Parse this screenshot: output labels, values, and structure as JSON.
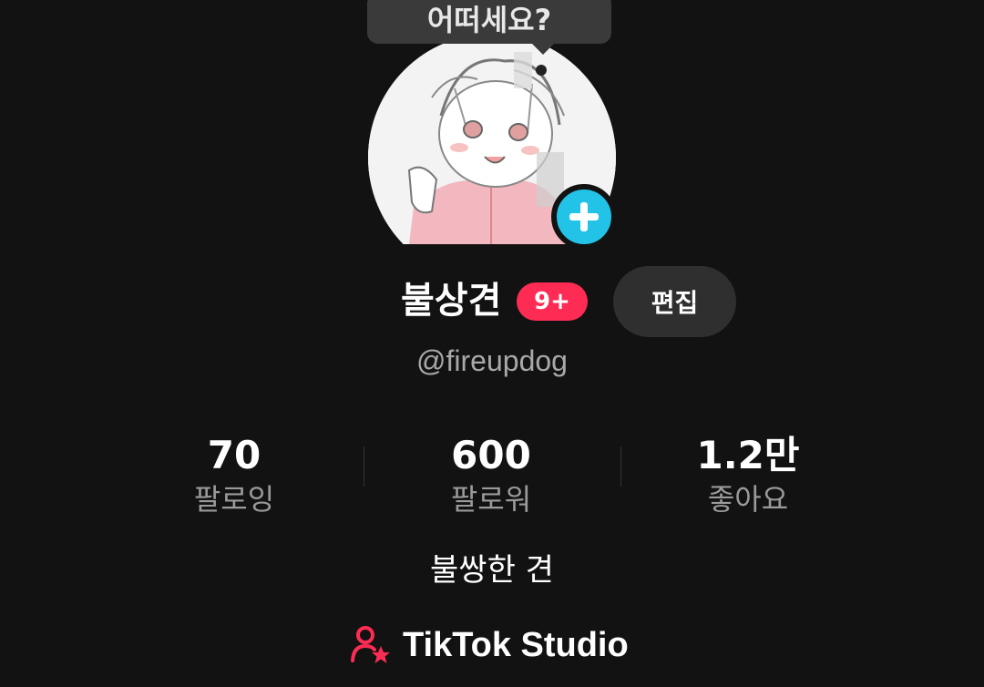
{
  "tooltip": {
    "text": "어떠세요?"
  },
  "profile": {
    "name": "불상견",
    "badge": "9+",
    "edit_label": "편집",
    "handle": "@fireupdog",
    "bio": "불쌍한 견"
  },
  "stats": [
    {
      "value": "70",
      "label": "팔로잉"
    },
    {
      "value": "600",
      "label": "팔로워"
    },
    {
      "value": "1.2만",
      "label": "좋아요"
    }
  ],
  "studio": {
    "label": "TikTok Studio",
    "icon": "user-star-icon"
  },
  "colors": {
    "background": "#121212",
    "accent_red": "#fe2c55",
    "accent_cyan": "#22c3e6"
  }
}
